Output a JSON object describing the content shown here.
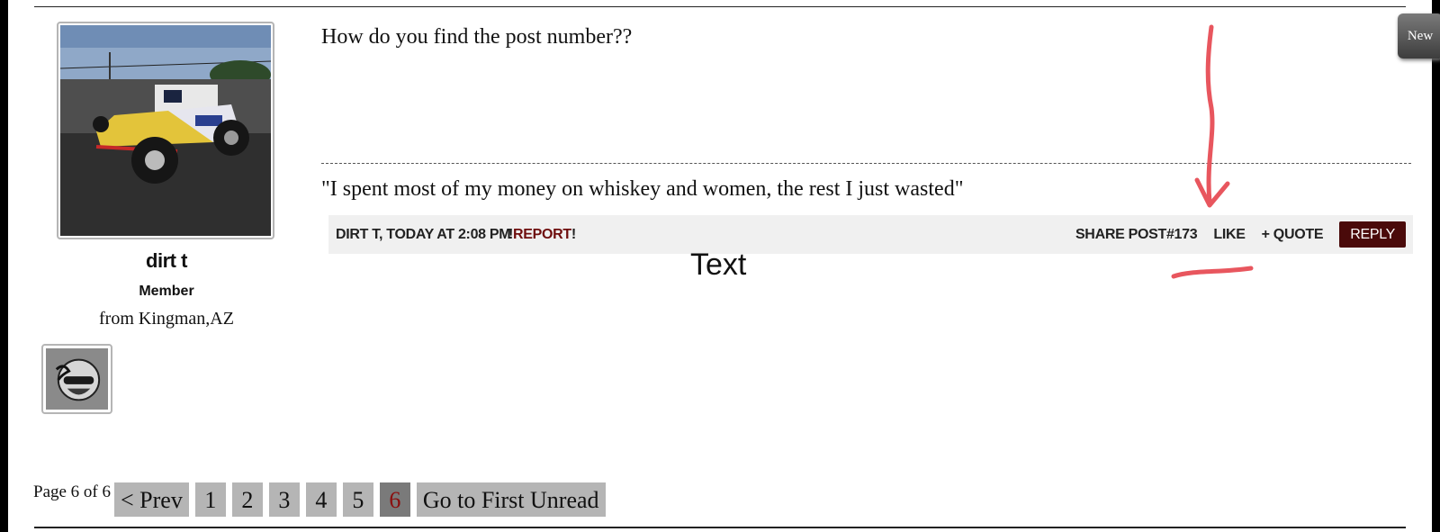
{
  "user": {
    "name": "dirt t",
    "role": "Member",
    "location": "from Kingman,AZ"
  },
  "post": {
    "body": "How do you find the post number??",
    "signature": "\"I spent most of my money on whiskey and women, the rest I just wasted\"",
    "meta": "dirt t, Today at 2:08 PM",
    "report_prefix": "!",
    "report_label": "Report",
    "report_suffix": "!",
    "share_label": "Share Post#173",
    "like_label": "Like",
    "quote_label": "+ Quote",
    "reply_label": "Reply"
  },
  "annotation": {
    "text": "Text",
    "color": "#e8565e"
  },
  "corner_badge": "New",
  "pagination": {
    "info": "Page 6 of 6",
    "prev": "< Prev",
    "pages": [
      "1",
      "2",
      "3",
      "4",
      "5",
      "6"
    ],
    "current": "6",
    "first_unread": "Go to First Unread"
  },
  "icons": {
    "avatar": "hot-rod-car-photo",
    "badge": "helmet-rider-photo"
  }
}
